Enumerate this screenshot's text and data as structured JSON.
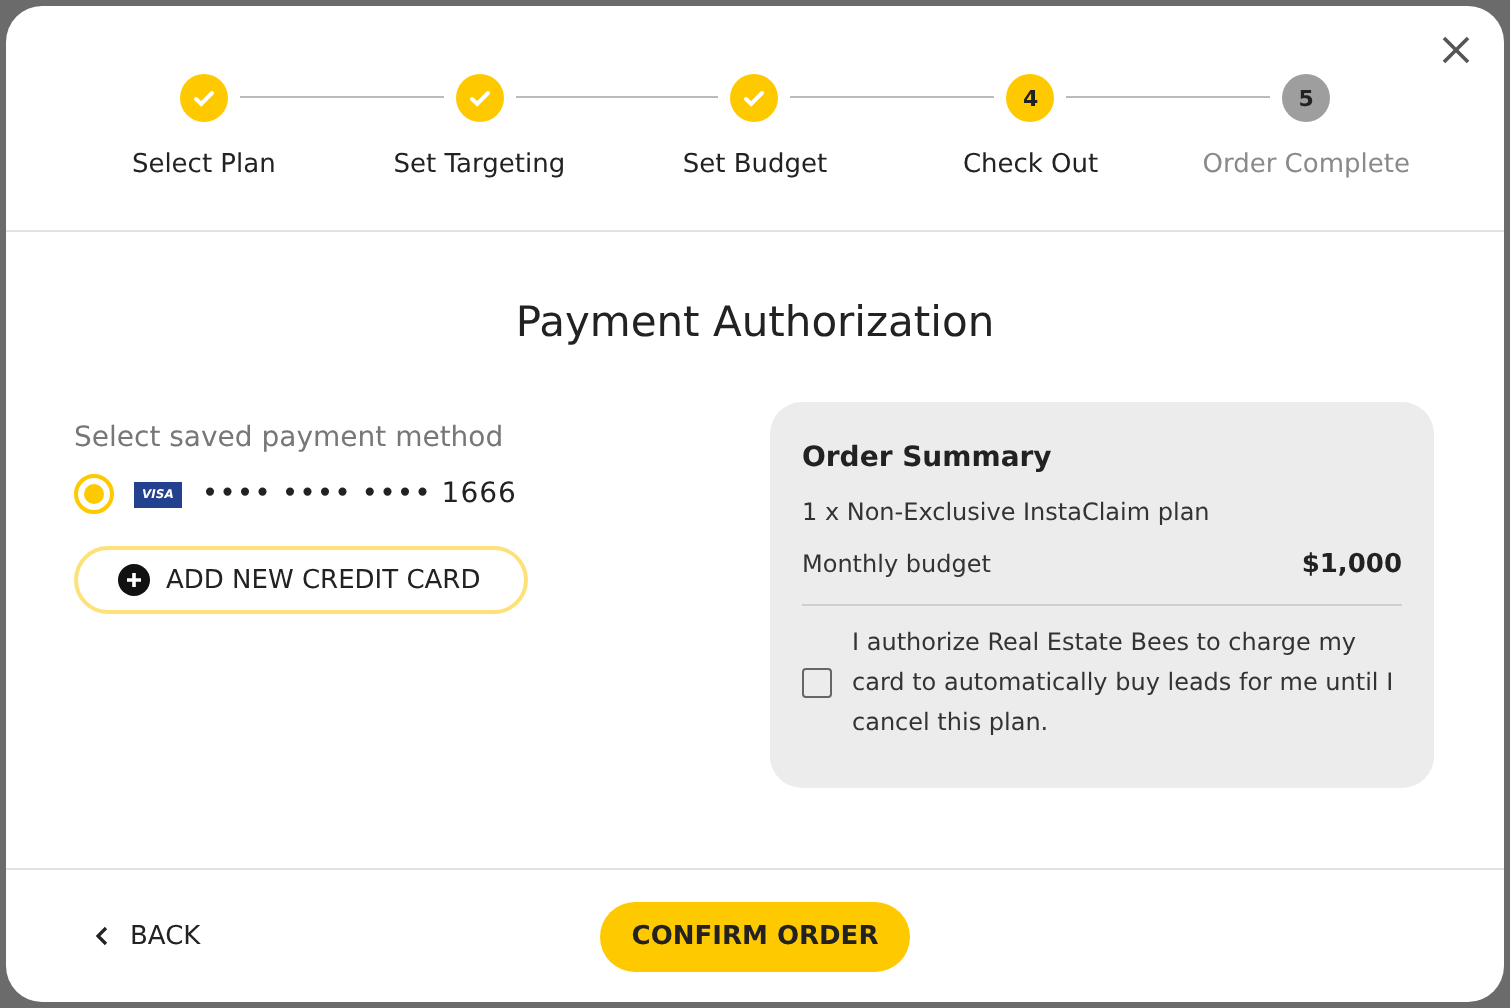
{
  "stepper": [
    {
      "label": "Select Plan",
      "kind": "done"
    },
    {
      "label": "Set Targeting",
      "kind": "done"
    },
    {
      "label": "Set Budget",
      "kind": "done"
    },
    {
      "label": "Check Out",
      "number": "4",
      "kind": "current"
    },
    {
      "label": "Order Complete",
      "number": "5",
      "kind": "upcoming"
    }
  ],
  "title": "Payment Authorization",
  "payment": {
    "label": "Select saved payment method",
    "methods": [
      {
        "brand": "VISA",
        "number": "•••• •••• •••• 1666",
        "selected": true
      }
    ],
    "add_button": "ADD NEW CREDIT CARD"
  },
  "summary": {
    "title": "Order Summary",
    "item": "1 x Non-Exclusive InstaClaim plan",
    "budget_label": "Monthly budget",
    "budget_value": "$1,000",
    "authorize": {
      "text": "I authorize Real Estate Bees to charge my card to automatically buy leads for me until I cancel this plan.",
      "checked": false
    }
  },
  "footer": {
    "back": "BACK",
    "confirm": "CONFIRM ORDER"
  }
}
